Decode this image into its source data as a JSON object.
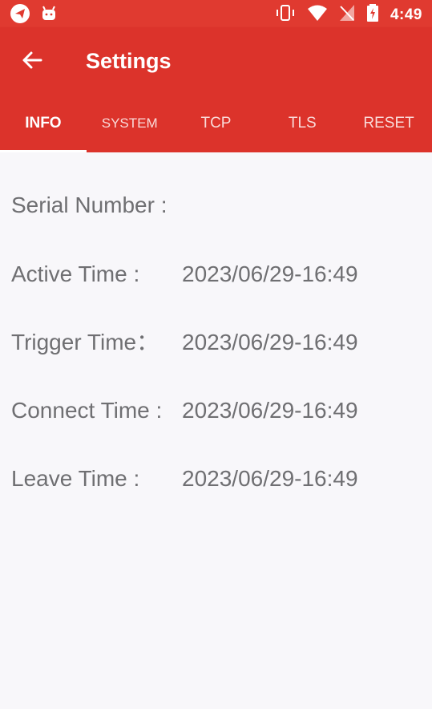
{
  "status_bar": {
    "time": "4:49",
    "left_icons": [
      "send-icon",
      "android-icon"
    ],
    "right_icons": [
      "vibrate-icon",
      "wifi-icon",
      "no-signal-icon",
      "battery-charging-icon"
    ]
  },
  "app_bar": {
    "title": "Settings",
    "back_icon": "arrow-left-icon"
  },
  "tabs": [
    {
      "label": "INFO",
      "active": true
    },
    {
      "label": "SYSTEM",
      "active": false
    },
    {
      "label": "TCP",
      "active": false
    },
    {
      "label": "TLS",
      "active": false
    },
    {
      "label": "RESET",
      "active": false
    }
  ],
  "info": {
    "serial_number": {
      "label": "Serial Number :",
      "value": ""
    },
    "active_time": {
      "label": "Active Time :",
      "value": "2023/06/29-16:49"
    },
    "trigger_time": {
      "label": "Trigger Time：",
      "value": "2023/06/29-16:49"
    },
    "connect_time": {
      "label": "Connect Time :",
      "value": "2023/06/29-16:49"
    },
    "leave_time": {
      "label": "Leave Time :",
      "value": "2023/06/29-16:49"
    }
  },
  "colors": {
    "primary": "#dc332b",
    "status_bar": "#e03a30",
    "background": "#f8f7fa",
    "text": "#6f6f72",
    "on_primary": "#ffffff"
  }
}
